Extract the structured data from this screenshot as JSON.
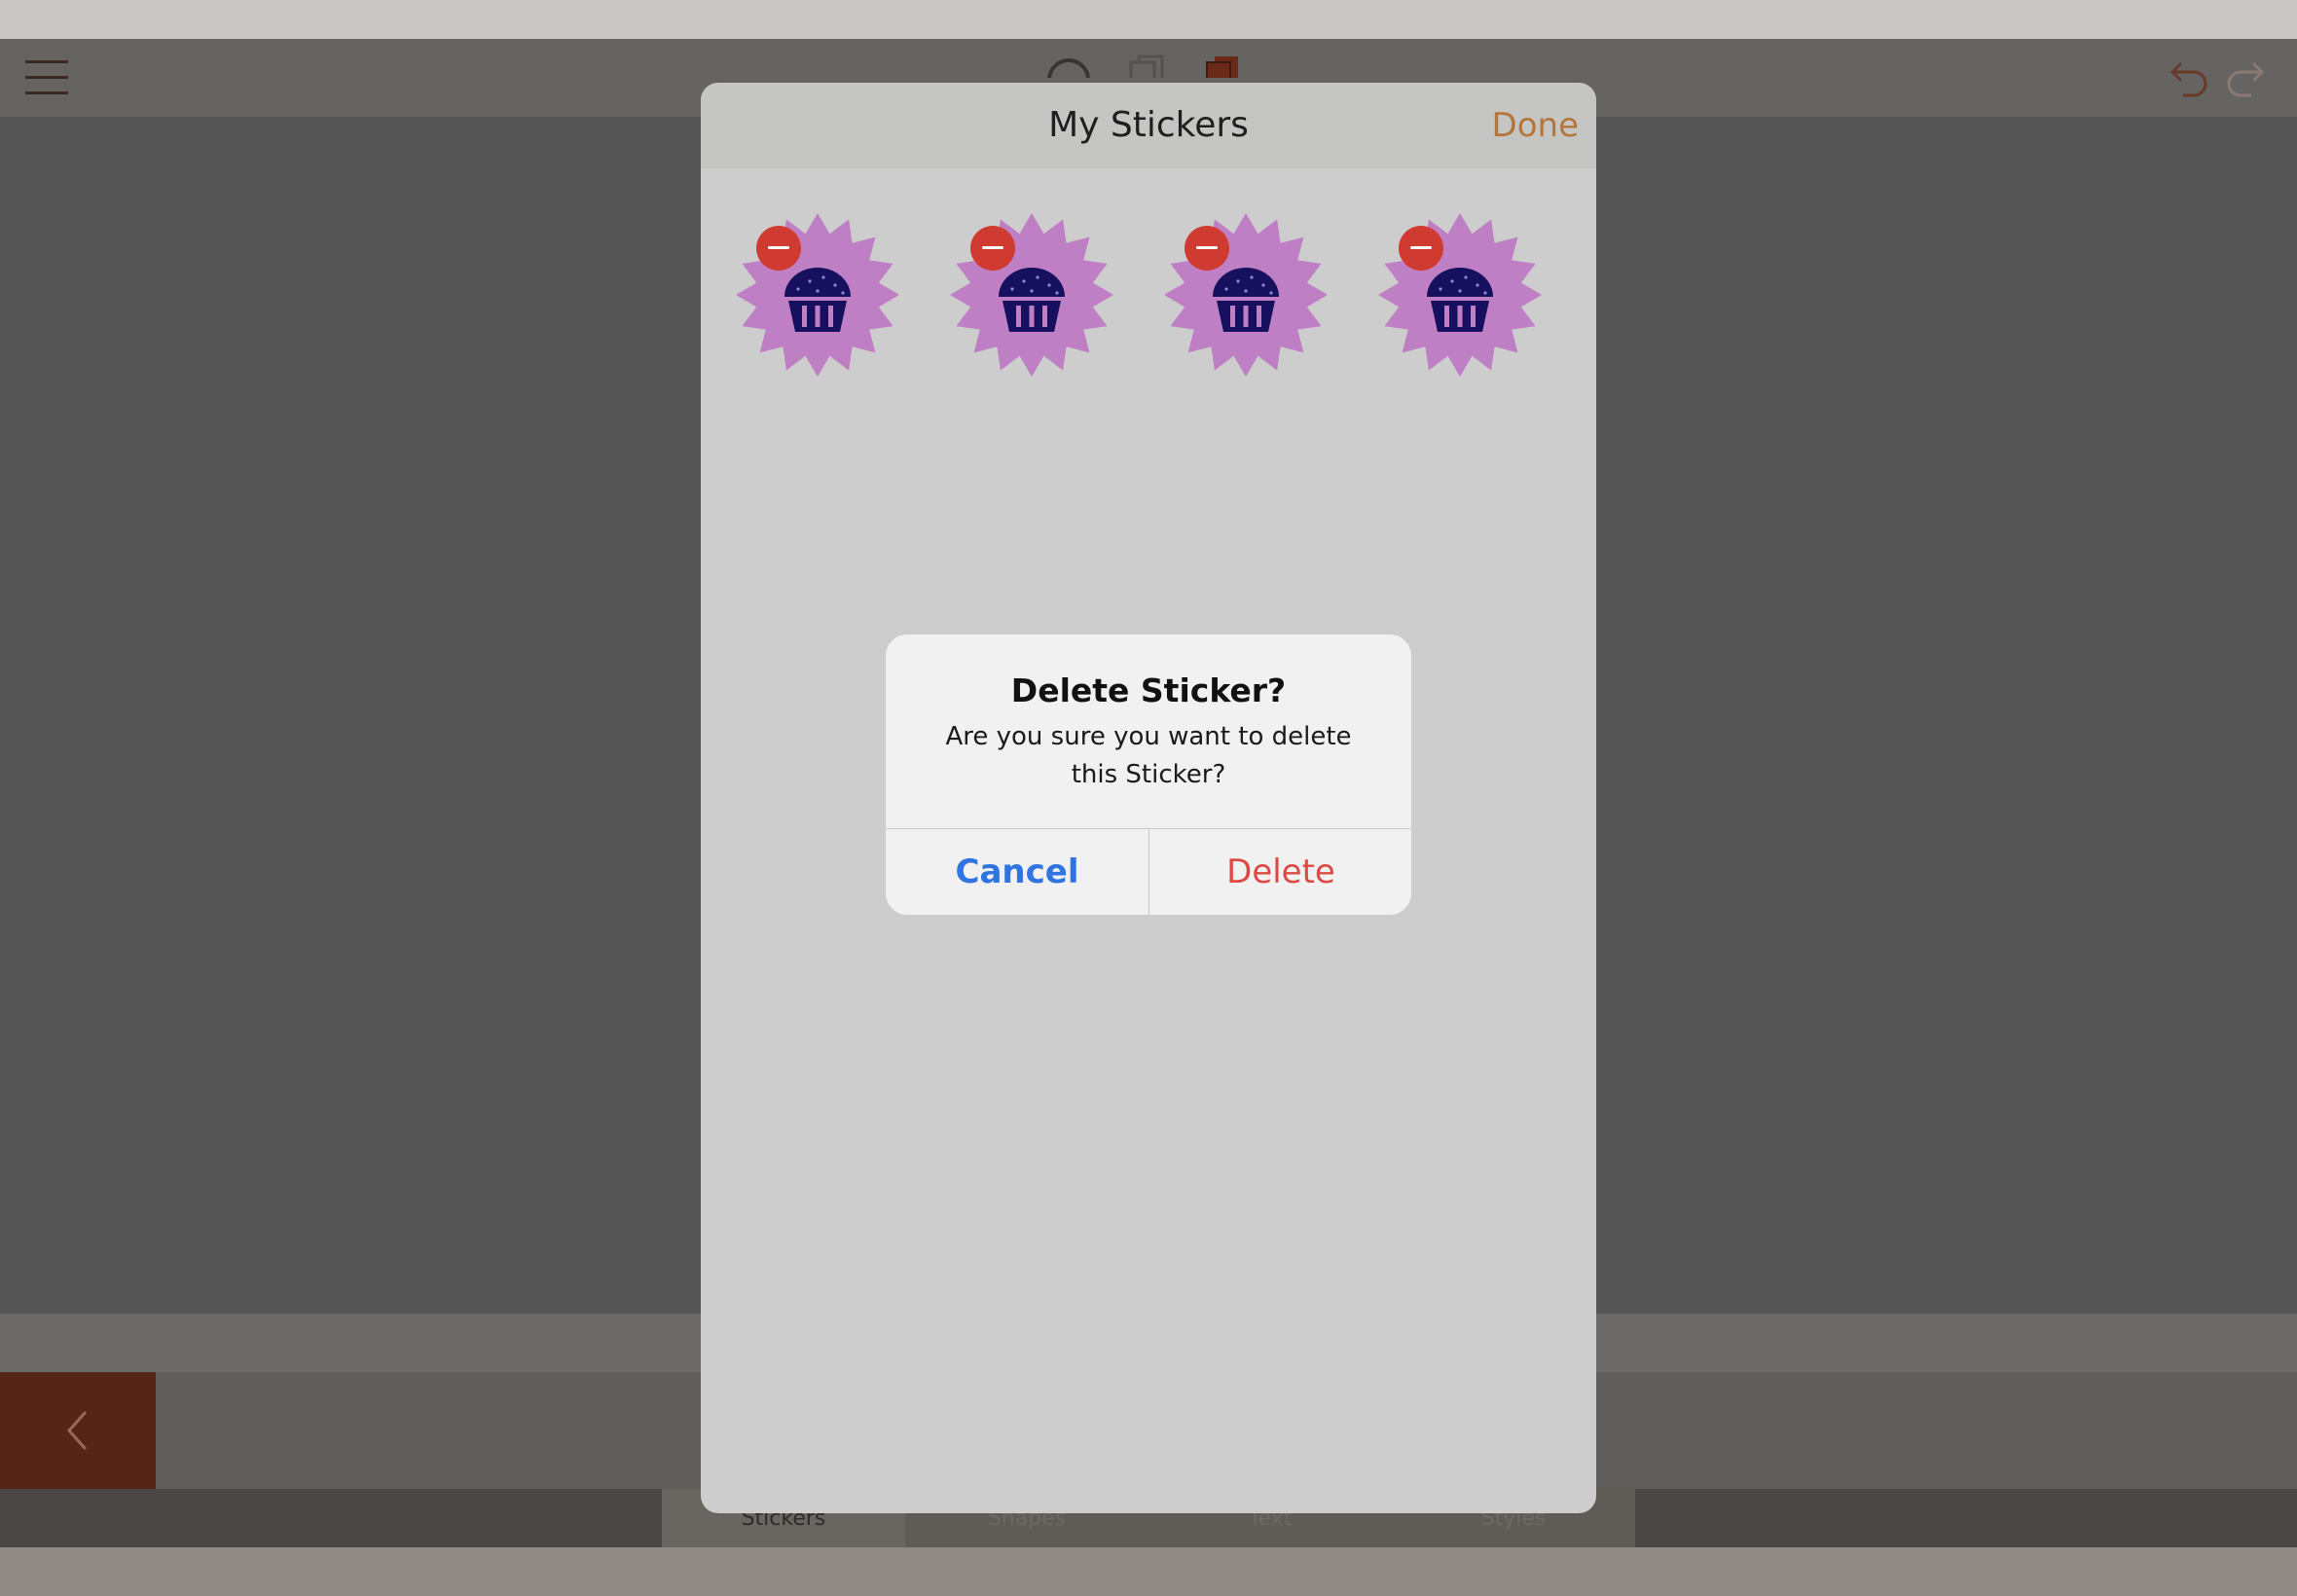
{
  "sheet": {
    "title": "My Stickers",
    "done_label": "Done"
  },
  "stickers": [
    {
      "name": "cupcake-sticker",
      "badge_color": "#bf7fc5",
      "icon_color": "#16105e"
    },
    {
      "name": "cupcake-sticker",
      "badge_color": "#bf7fc5",
      "icon_color": "#16105e"
    },
    {
      "name": "cupcake-sticker",
      "badge_color": "#bf7fc5",
      "icon_color": "#16105e"
    },
    {
      "name": "cupcake-sticker",
      "badge_color": "#bf7fc5",
      "icon_color": "#16105e"
    }
  ],
  "alert": {
    "title": "Delete Sticker?",
    "message": "Are you sure you want to delete this Sticker?",
    "cancel_label": "Cancel",
    "delete_label": "Delete"
  },
  "bottom_tabs": [
    {
      "label": "Stickers",
      "active": true
    },
    {
      "label": "Shapes",
      "active": false
    },
    {
      "label": "Text",
      "active": false
    },
    {
      "label": "Styles",
      "active": false
    }
  ],
  "toolbar_icons": [
    "menu-icon",
    "search-icon",
    "page-copy-icon",
    "page-icon",
    "undo-icon",
    "redo-icon"
  ],
  "colors": {
    "accent": "#b4763b",
    "remove_badge": "#cf3b30",
    "cancel_blue": "#2f74e0",
    "delete_red": "#dd4a43",
    "back_tile": "#552617"
  }
}
